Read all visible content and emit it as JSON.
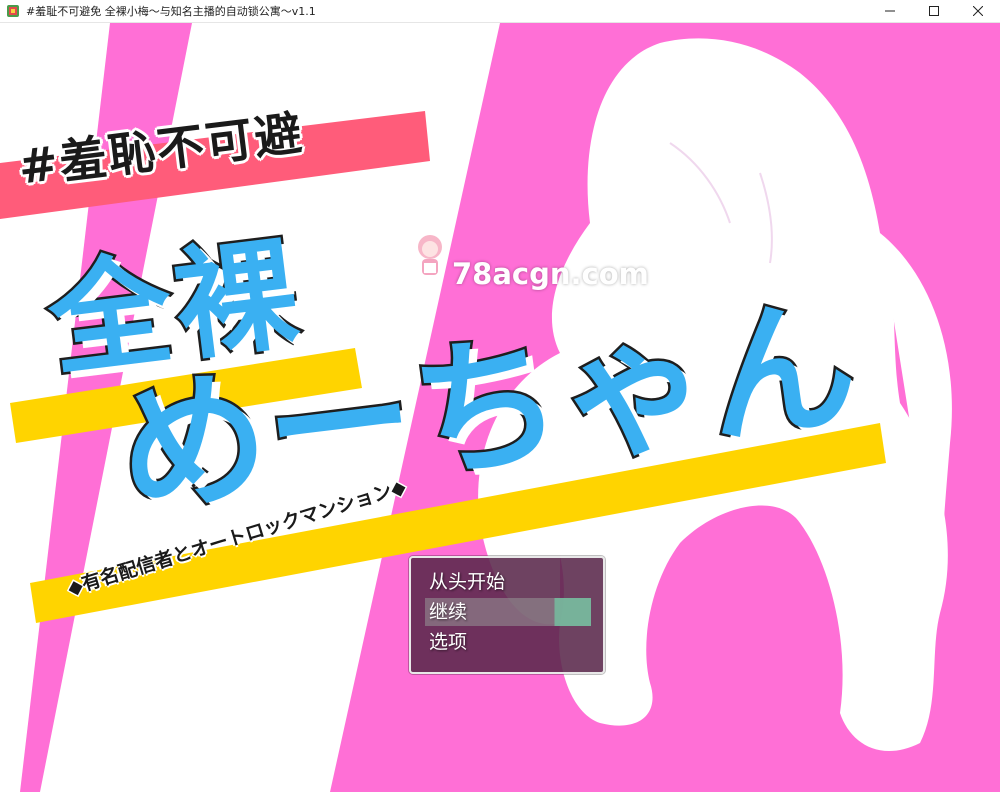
{
  "window": {
    "title": "#羞耻不可避免 全裸小梅～与知名主播的自动锁公寓～v1.1",
    "controls": {
      "minimize": "minimize-icon",
      "maximize": "maximize-icon",
      "close": "close-icon"
    }
  },
  "game": {
    "logo": {
      "hashtag": "#羞恥不可避",
      "title_line1": "全裸",
      "title_line2": "めーちゃん",
      "tagline": "◆有名配信者とオートロックマンション◆"
    },
    "watermark": "78acgn.com",
    "menu": {
      "items": [
        {
          "label": "从头开始",
          "selected": false
        },
        {
          "label": "继续",
          "selected": true
        },
        {
          "label": "选项",
          "selected": false
        }
      ]
    },
    "colors": {
      "background_pink": "#ff6fd6",
      "stripe_white": "#ffffff",
      "band_red": "#ff5c7a",
      "band_yellow": "#ffd400",
      "title_blue": "#3ab0f2"
    }
  }
}
